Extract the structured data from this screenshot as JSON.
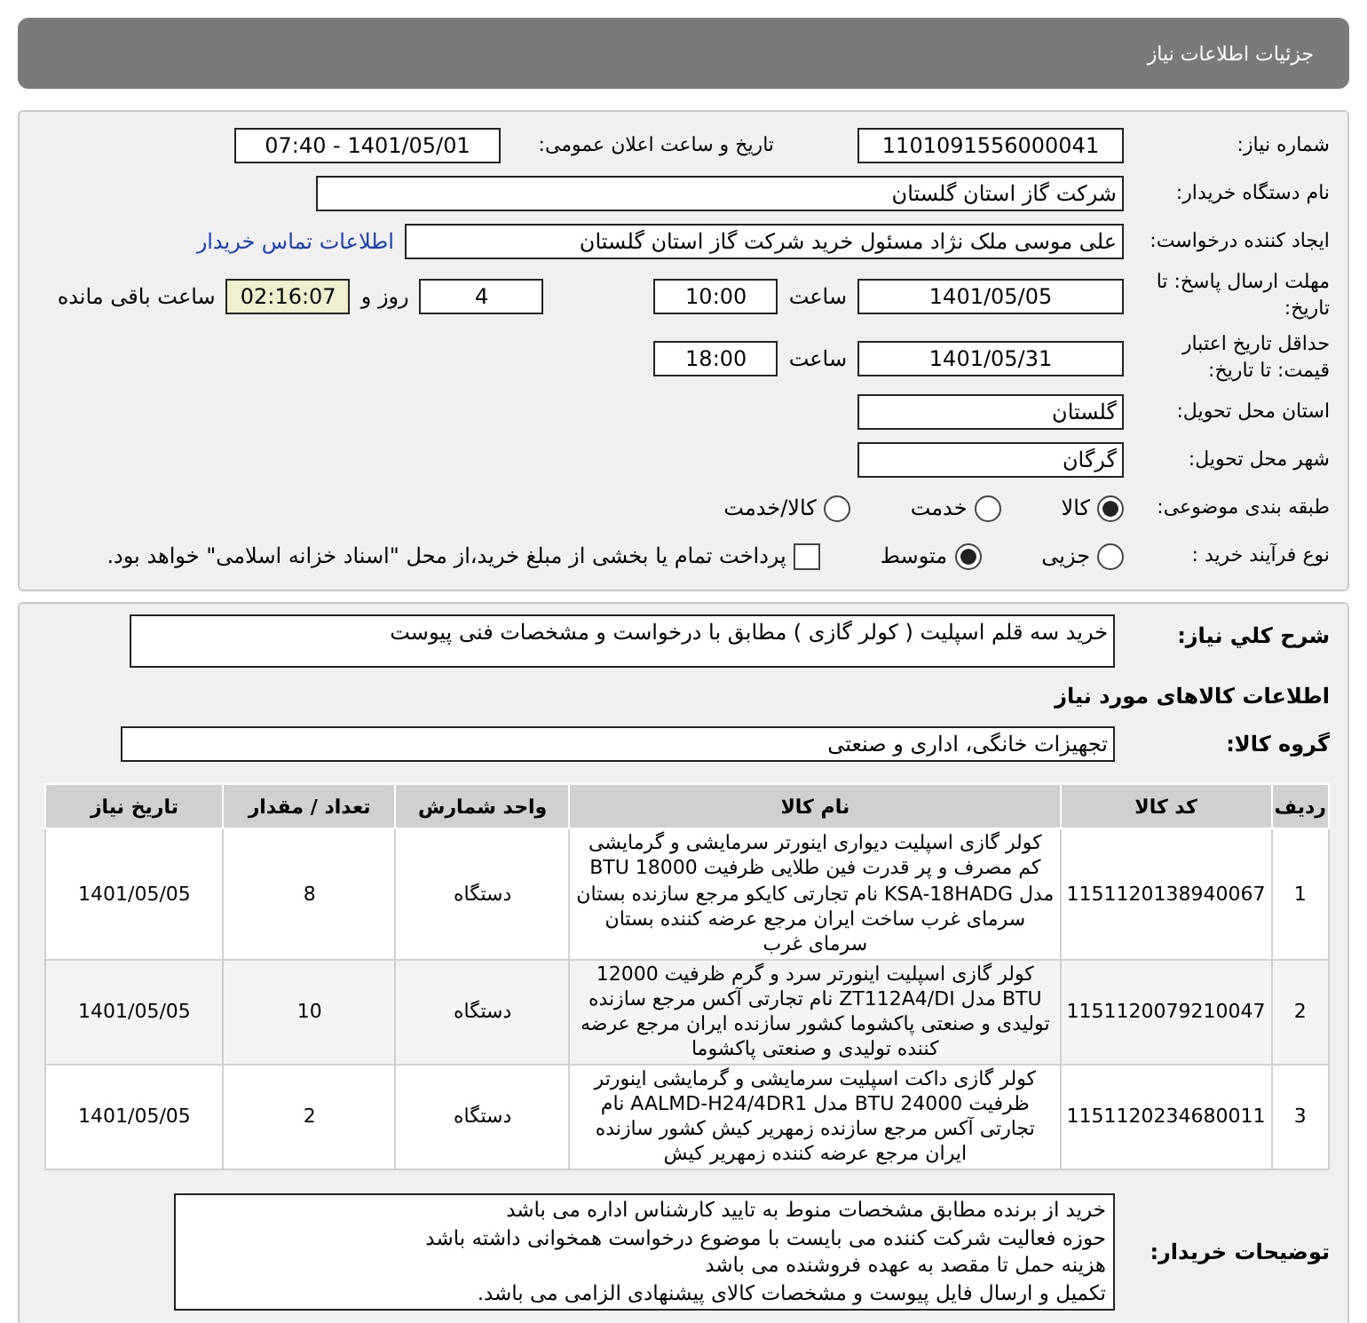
{
  "title": "جزئیات اطلاعات نیاز",
  "need_number": {
    "label": "شماره نیاز:",
    "value": "1101091556000041"
  },
  "announce": {
    "label": "تاریخ و ساعت اعلان عمومی:",
    "value": "1401/05/01 - 07:40"
  },
  "buyer_org": {
    "label": "نام دستگاه خریدار:",
    "value": "شرکت گاز استان گلستان"
  },
  "requester": {
    "label": "ایجاد کننده درخواست:",
    "value": "علی موسی ملک نژاد مسئول خرید شرکت گاز استان گلستان",
    "contact_link": "اطلاعات تماس خریدار"
  },
  "deadline": {
    "label": "مهلت ارسال پاسخ: تا تاریخ:",
    "date": "1401/05/05",
    "time_label": "ساعت",
    "time": "10:00",
    "days": "4",
    "days_label": "روز و",
    "remaining": "02:16:07",
    "remaining_label": "ساعت باقی مانده"
  },
  "validity": {
    "label": "حداقل تاریخ اعتبار قیمت: تا تاریخ:",
    "date": "1401/05/31",
    "time_label": "ساعت",
    "time": "18:00"
  },
  "province": {
    "label": "استان محل تحویل:",
    "value": "گلستان"
  },
  "city": {
    "label": "شهر محل تحویل:",
    "value": "گرگان"
  },
  "category": {
    "label": "طبقه بندی موضوعی:",
    "options": [
      {
        "label": "کالا",
        "selected": true
      },
      {
        "label": "خدمت",
        "selected": false
      },
      {
        "label": "کالا/خدمت",
        "selected": false
      }
    ]
  },
  "process": {
    "label": "نوع فرآیند خرید :",
    "options": [
      {
        "label": "جزیی",
        "selected": false
      },
      {
        "label": "متوسط",
        "selected": true
      }
    ],
    "payment": {
      "label": "پرداخت تمام یا بخشی از مبلغ خرید،از محل \"اسناد خزانه اسلامی\" خواهد بود.",
      "checked": false
    }
  },
  "summary": {
    "label": "شرح کلي نياز:",
    "value": "خرید سه قلم اسپلیت ( کولر گازی ) مطابق با درخواست و مشخصات فنی پیوست"
  },
  "goods_heading": "اطلاعات کالاهای مورد نیاز",
  "group": {
    "label": "گروه کالا:",
    "value": "تجهیزات خانگی، اداری و صنعتی"
  },
  "table": {
    "columns": [
      "ردیف",
      "کد کالا",
      "نام کالا",
      "واحد شمارش",
      "تعداد / مقدار",
      "تاریخ نیاز"
    ],
    "rows": [
      [
        "1",
        "1151120138940067",
        "کولر گازی اسپلیت دیواری اینورتر سرمایشی و گرمایشی کم مصرف و پر قدرت فین طلایی ظرفیت 18000 BTU مدل KSA-18HADG نام تجارتی کایکو مرجع سازنده بستان سرمای غرب ساخت ایران مرجع عرضه کننده بستان سرمای غرب",
        "دستگاه",
        "8",
        "1401/05/05"
      ],
      [
        "2",
        "1151120079210047",
        "کولر گازی اسپلیت اینورتر سرد و گرم ظرفیت 12000 BTU مدل ZT112A4/DI نام تجارتی آکس مرجع سازنده تولیدی و صنعتی پاکشوما کشور سازنده ایران مرجع عرضه کننده تولیدی و صنعتی پاکشوما",
        "دستگاه",
        "10",
        "1401/05/05"
      ],
      [
        "3",
        "1151120234680011",
        "کولر گازی داکت اسپلیت سرمایشی و گرمایشی اینورتر ظرفیت 24000 BTU مدل AALMD-H24/4DR1 نام تجارتی آکس مرجع سازنده زمهریر کیش کشور سازنده ایران مرجع عرضه کننده زمهریر کیش",
        "دستگاه",
        "2",
        "1401/05/05"
      ]
    ]
  },
  "notes": {
    "label": "توضیحات خریدار:",
    "lines": [
      "خرید از برنده مطابق مشخصات منوط به تایید کارشناس اداره می باشد",
      "حوزه فعالیت شرکت کننده می بایست با موضوع درخواست همخوانی داشته باشد",
      "هزینه حمل تا مقصد به عهده فروشنده می باشد",
      "تکمیل و ارسال فایل پیوست و مشخصات کالای پیشنهادی الزامی می باشد."
    ]
  }
}
